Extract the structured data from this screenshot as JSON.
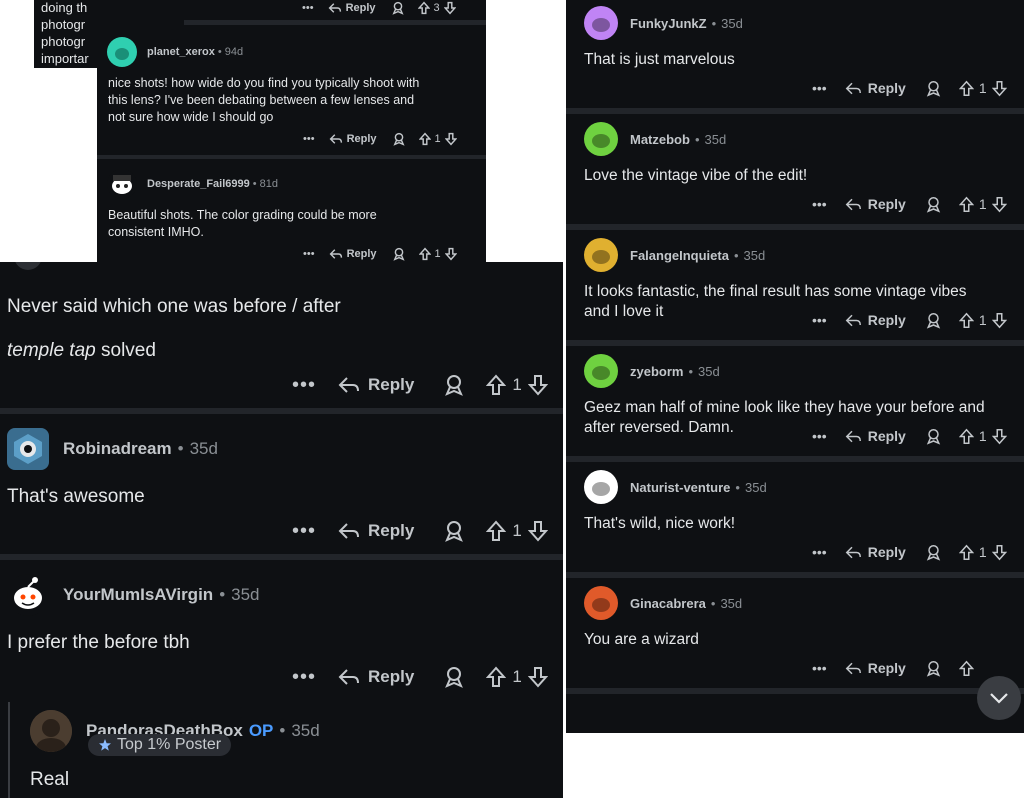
{
  "top_fragment": {
    "lines": [
      "doing th",
      "photogr",
      "photogr",
      "importar"
    ],
    "vote_count": "3",
    "reply_label": "Reply"
  },
  "small_comments": [
    {
      "user": "planet_xerox",
      "age": "94d",
      "text_lines": [
        "nice shots! how wide do you find you typically shoot with",
        "this lens? I've been debating between a few lenses and",
        "not sure how wide I should go"
      ],
      "votes": "1",
      "reply_label": "Reply"
    },
    {
      "user": "Desperate_Fail6999",
      "age": "81d",
      "text_lines": [
        "Beautiful shots. The color grading could be more",
        "consistent IMHO."
      ],
      "votes": "1",
      "reply_label": "Reply"
    }
  ],
  "left_comments": {
    "first": {
      "line1": "Never said which one was before / after",
      "italic": "temple tap",
      "rest": " solved",
      "votes": "1",
      "reply_label": "Reply"
    },
    "robin": {
      "user": "Robinadream",
      "age": "35d",
      "text": "That's awesome",
      "votes": "1",
      "reply_label": "Reply"
    },
    "yourmum": {
      "user": "YourMumIsAVirgin",
      "age": "35d",
      "text": "I prefer the before tbh",
      "votes": "1",
      "reply_label": "Reply"
    },
    "pandora": {
      "user": "PandorasDeathBox",
      "op": "OP",
      "age": "35d",
      "badge": "Top 1% Poster",
      "text": "Real"
    }
  },
  "right_comments": [
    {
      "user": "FunkyJunkZ",
      "age": "35d",
      "text_lines": [
        "That is just marvelous"
      ],
      "votes": "1",
      "reply_label": "Reply"
    },
    {
      "user": "Matzebob",
      "age": "35d",
      "text_lines": [
        "Love the vintage vibe of the edit!"
      ],
      "votes": "1",
      "reply_label": "Reply"
    },
    {
      "user": "FalangeInquieta",
      "age": "35d",
      "text_lines": [
        "It looks fantastic, the final result has some vintage vibes",
        "and I love it"
      ],
      "votes": "1",
      "reply_label": "Reply"
    },
    {
      "user": "zyeborm",
      "age": "35d",
      "text_lines": [
        "Geez man half of mine look like they have your before and",
        "after reversed. Damn."
      ],
      "votes": "1",
      "reply_label": "Reply"
    },
    {
      "user": "Naturist-venture",
      "age": "35d",
      "text_lines": [
        "That's wild, nice work!"
      ],
      "votes": "1",
      "reply_label": "Reply"
    },
    {
      "user": "Ginacabrera",
      "age": "35d",
      "text_lines": [
        "You are a wizard"
      ],
      "votes": "",
      "reply_label": "Reply"
    }
  ],
  "icons": {
    "more": "more-options-icon",
    "reply": "reply-arrow-icon",
    "award": "award-icon",
    "upvote": "upvote-arrow-icon",
    "downvote": "downvote-arrow-icon",
    "scroll": "chevron-down-icon"
  },
  "colors": {
    "background": "#0e1013",
    "separator": "#22252a",
    "op": "#4a9bff"
  }
}
